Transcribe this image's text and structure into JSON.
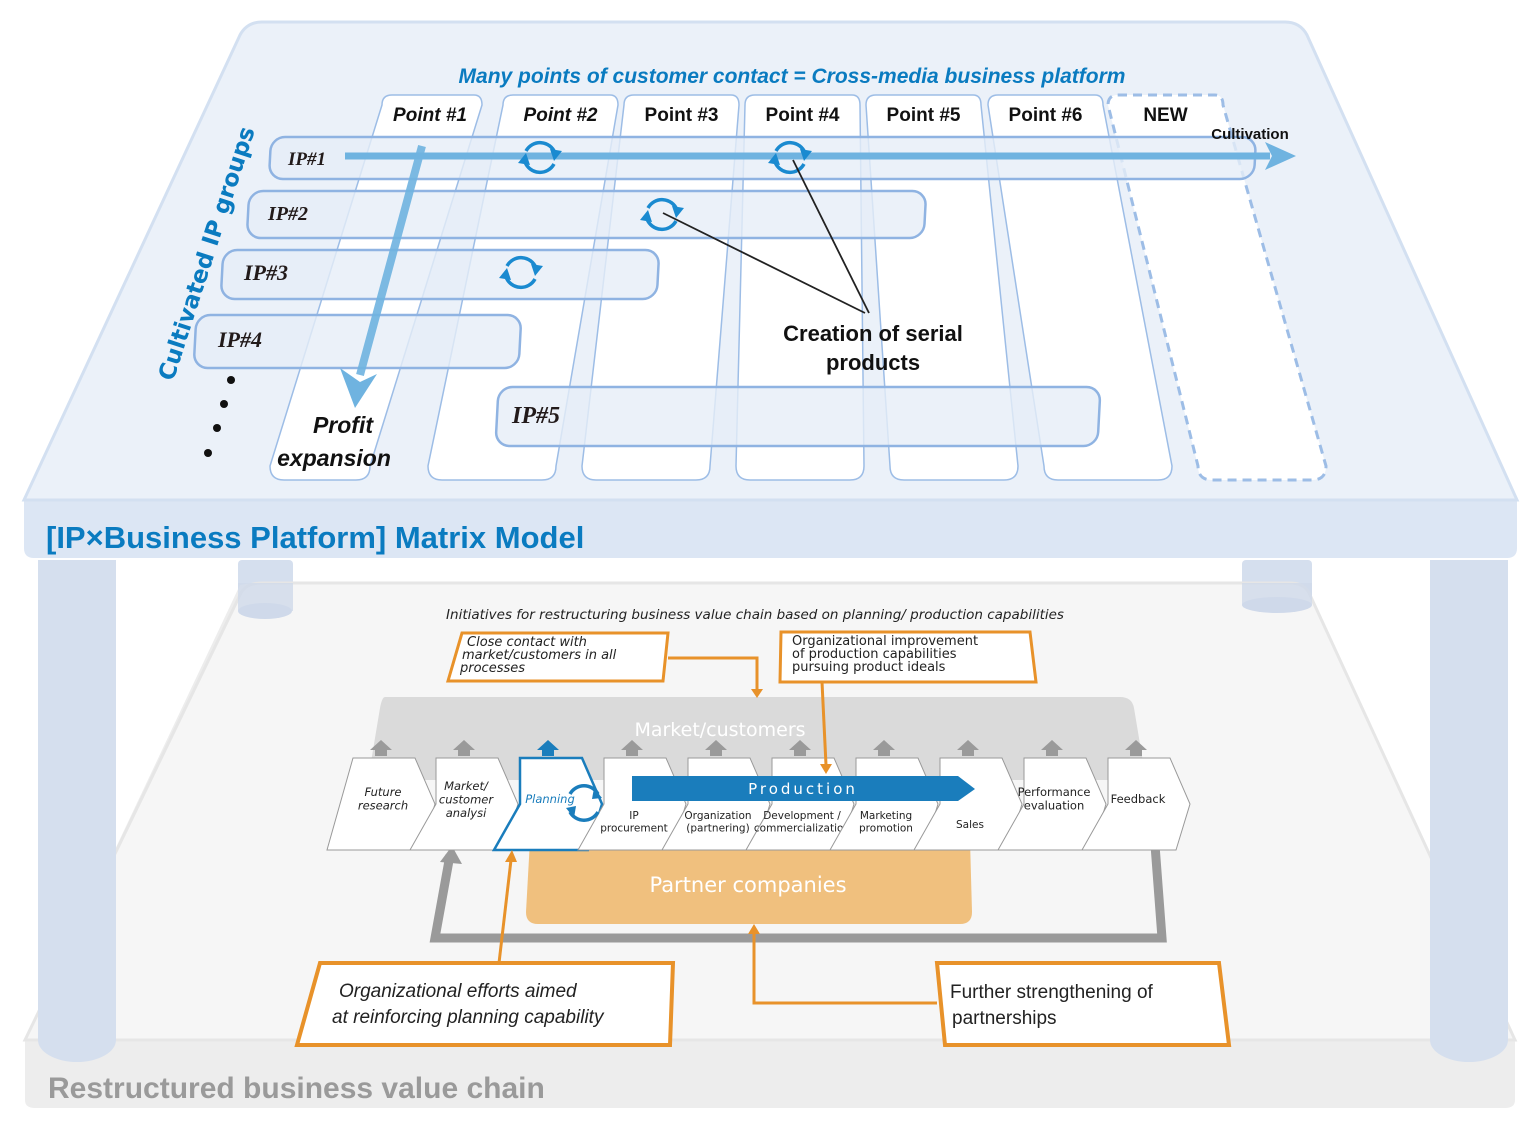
{
  "top_platform": {
    "headline": "Many points of customer contact = Cross-media business platform",
    "title": "[IP×Business Platform] Matrix Model",
    "axis_label": "Cultivated IP groups",
    "points": [
      "Point #1",
      "Point #2",
      "Point #3",
      "Point #4",
      "Point #5",
      "Point #6",
      "NEW"
    ],
    "ip_groups": [
      "IP#1",
      "IP#2",
      "IP#3",
      "IP#4",
      "IP#5"
    ],
    "cultivation_label": "Cultivation",
    "profit_label_line1": "Profit",
    "profit_label_line2": "expansion",
    "serial_label_line1": "Creation of serial",
    "serial_label_line2": "products",
    "ellipsis": "…"
  },
  "bottom_platform": {
    "title": "Restructured business value chain",
    "subtitle": "Initiatives for restructuring business value chain based on planning/ production capabilities",
    "market_label": "Market/customers",
    "production_label": "Production",
    "partner_label": "Partner companies",
    "steps": [
      {
        "line1": "Future",
        "line2": "research",
        "line3": ""
      },
      {
        "line1": "Market/",
        "line2": "customer",
        "line3": "analysi"
      },
      {
        "line1": "Planning",
        "line2": "",
        "line3": ""
      },
      {
        "line1": "IP",
        "line2": "procurement",
        "line3": ""
      },
      {
        "line1": "Organization",
        "line2": "(partnering)",
        "line3": ""
      },
      {
        "line1": "Development /",
        "line2": "commercialization",
        "line3": ""
      },
      {
        "line1": "Marketing",
        "line2": "promotion",
        "line3": ""
      },
      {
        "line1": "Sales",
        "line2": "",
        "line3": ""
      },
      {
        "line1": "Performance",
        "line2": "evaluation",
        "line3": ""
      },
      {
        "line1": "Feedback",
        "line2": "",
        "line3": ""
      }
    ],
    "callouts": {
      "close_contact": [
        "Close contact with",
        "market/customers in all",
        "processes"
      ],
      "org_improvement": [
        "Organizational improvement",
        "of production capabilities",
        "pursuing product ideals"
      ],
      "planning_efforts": [
        "Organizational efforts aimed",
        "at reinforcing planning capability"
      ],
      "partnerships": [
        "Further strengthening of",
        "partnerships"
      ]
    }
  },
  "colors": {
    "brand_blue": "#0a7bc0",
    "light_blue": "#dce6f2",
    "orange": "#e8922a",
    "partner_fill": "#f0c07e",
    "gray_arrow": "#999999"
  }
}
